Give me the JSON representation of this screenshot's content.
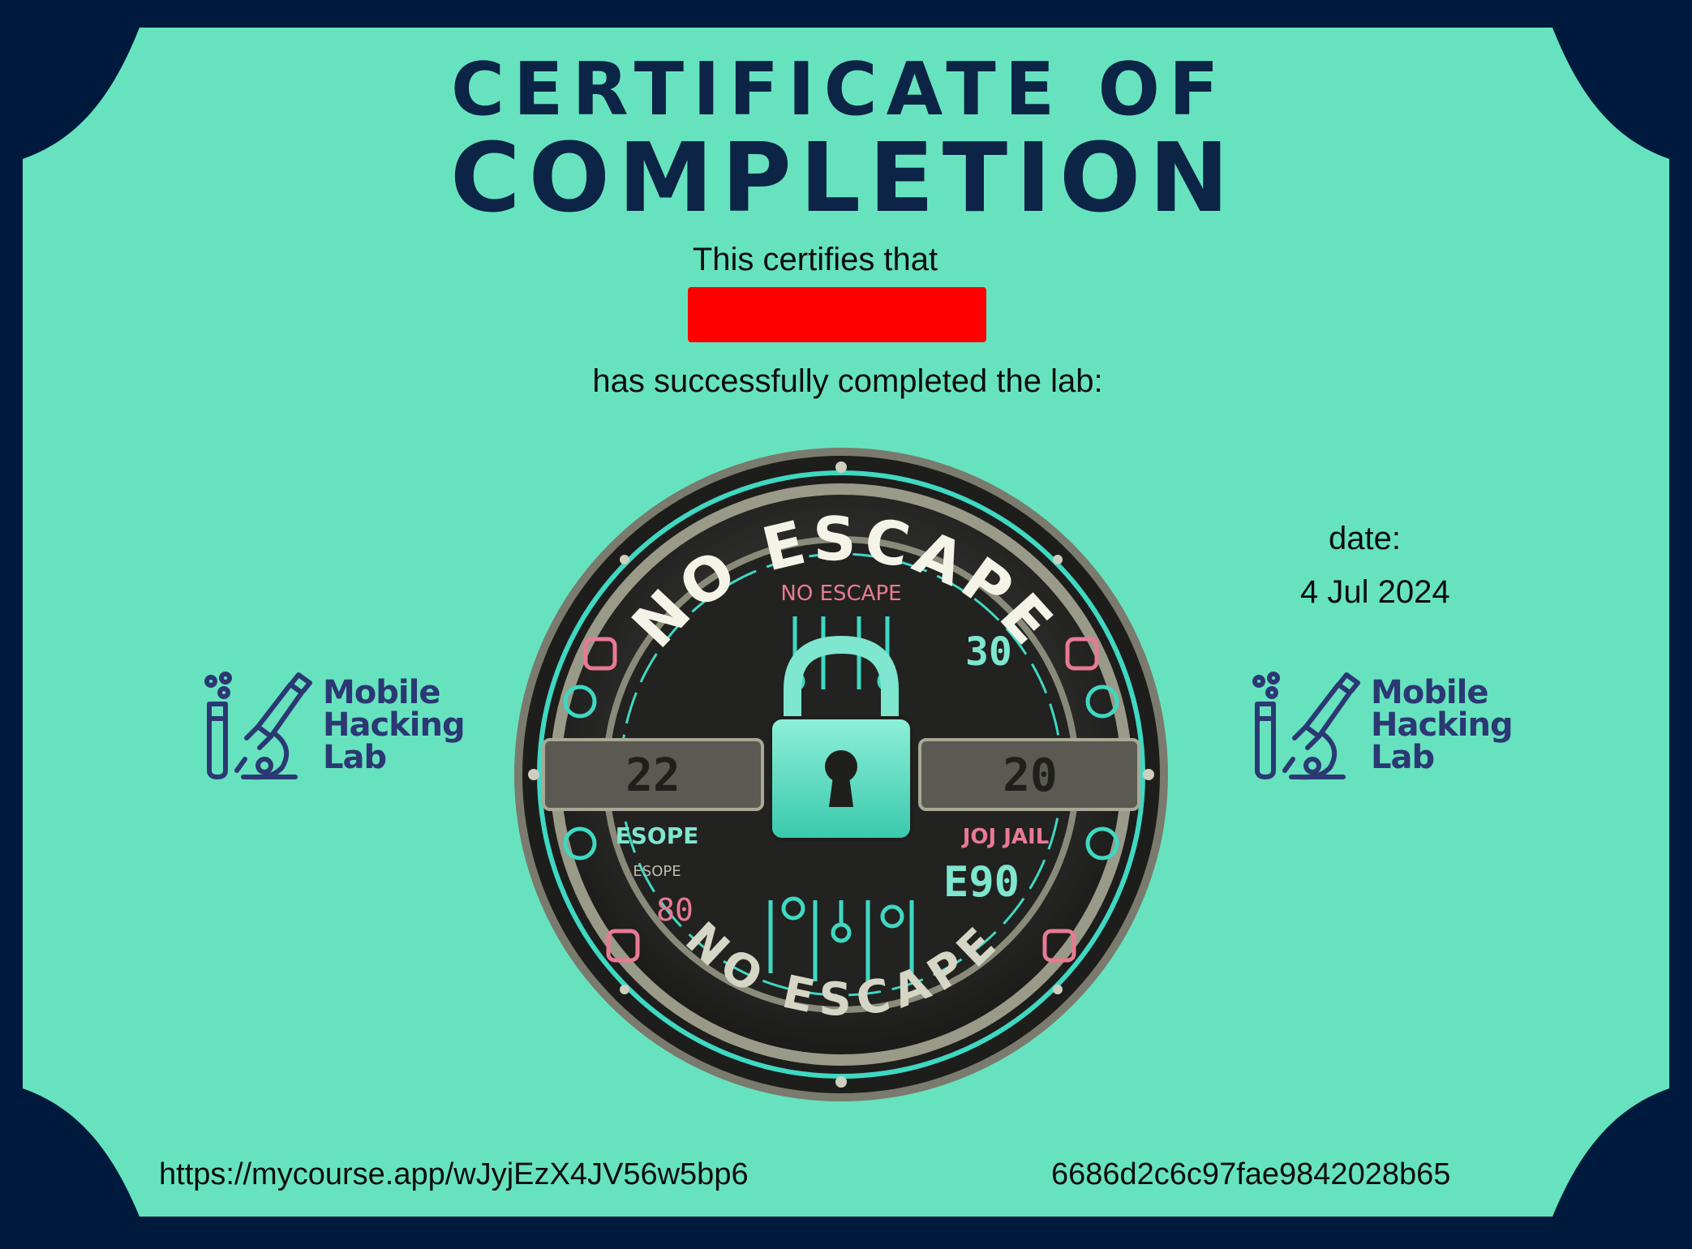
{
  "title": {
    "line1": "CERTIFICATE OF",
    "line2": "COMPLETION"
  },
  "certifies_text": "This certifies that",
  "recipient_name_redacted": true,
  "completed_text": "has successfully completed the lab:",
  "date": {
    "label": "date:",
    "value": "4 Jul 2024"
  },
  "url": "https://mycourse.app/wJyjEzX4JV56w5bp6",
  "certificate_id": "6686d2c6c97fae9842028b65",
  "logo": {
    "line1": "Mobile",
    "line2": "Hacking",
    "line3": "Lab"
  },
  "badge": {
    "top_arc_text": "NO ESCAPE",
    "inner_title": "NO ESCAPE",
    "left_number": "22",
    "right_number": "20",
    "upper_right_number": "30",
    "left_label": "ESOPE",
    "left_small_label": "ESOPE",
    "left_code": "80",
    "right_label": "JOJ JAIL",
    "right_code": "E90",
    "bottom_arc_text": "NO ESCAPE"
  },
  "colors": {
    "background_border": "#001a3d",
    "panel": "#66e3be",
    "title": "#0c2446",
    "redaction": "#ff0000",
    "logo": "#2b3873",
    "badge_teal": "#3fd8c2",
    "badge_pink": "#e87a94"
  }
}
